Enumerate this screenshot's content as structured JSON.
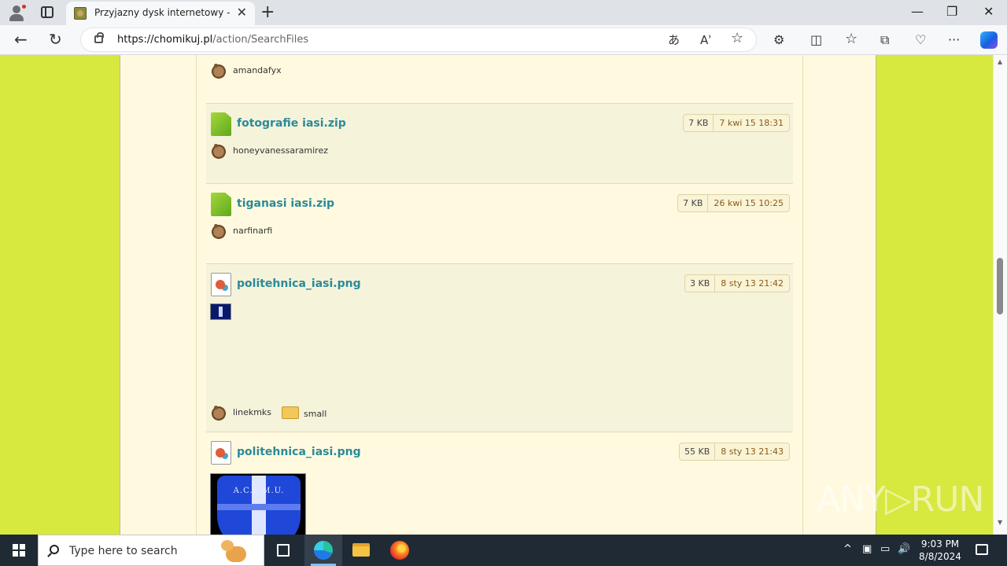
{
  "browser": {
    "tab_title": "Przyjazny dysk internetowy - Chomikuj.pl",
    "url_domain": "https://chomikuj.pl",
    "url_path": "/action/SearchFiles",
    "newtab_glyph": "+",
    "close_glyph": "✕",
    "back_glyph": "←",
    "refresh_glyph": "↻",
    "minimize_glyph": "—",
    "restore_glyph": "❐",
    "window_close_glyph": "✕",
    "read_aloud_glyph": "Aʾ",
    "translate_glyph": "あ",
    "favorite_glyph": "☆",
    "extensions_glyph": "⚙",
    "split_glyph": "◫",
    "favorites_glyph": "☆",
    "collections_glyph": "⧉",
    "performance_glyph": "♡",
    "more_glyph": "···"
  },
  "results": [
    {
      "owner": "amandafyx"
    },
    {
      "file_name": "fotografie iasi.zip",
      "type": "zip",
      "size": "7 KB",
      "date": "7 kwi 15 18:31",
      "owner": "honeyvanessaramirez"
    },
    {
      "file_name": "tiganasi iasi.zip",
      "type": "zip",
      "size": "7 KB",
      "date": "26 kwi 15 10:25",
      "owner": "narfinarfi"
    },
    {
      "file_name": "politehnica_iasi.png",
      "type": "png",
      "size": "3 KB",
      "date": "8 sty 13 21:42",
      "owner": "linekmks",
      "folder": "small"
    },
    {
      "file_name": "politehnica_iasi.png",
      "type": "png",
      "size": "55 KB",
      "date": "8 sty 13 21:43",
      "thumb_text": "A.C.S.M.U."
    }
  ],
  "watermark": "ANY▷RUN",
  "taskbar": {
    "search_placeholder": "Type here to search",
    "time": "9:03 PM",
    "date": "8/8/2024",
    "tray_chevron": "^",
    "tray_volume": "🔊"
  },
  "colors": {
    "page_background": "#d7e83f",
    "content_background": "#fffadf",
    "link_color": "#2a8a99",
    "date_color": "#8a5a16"
  }
}
